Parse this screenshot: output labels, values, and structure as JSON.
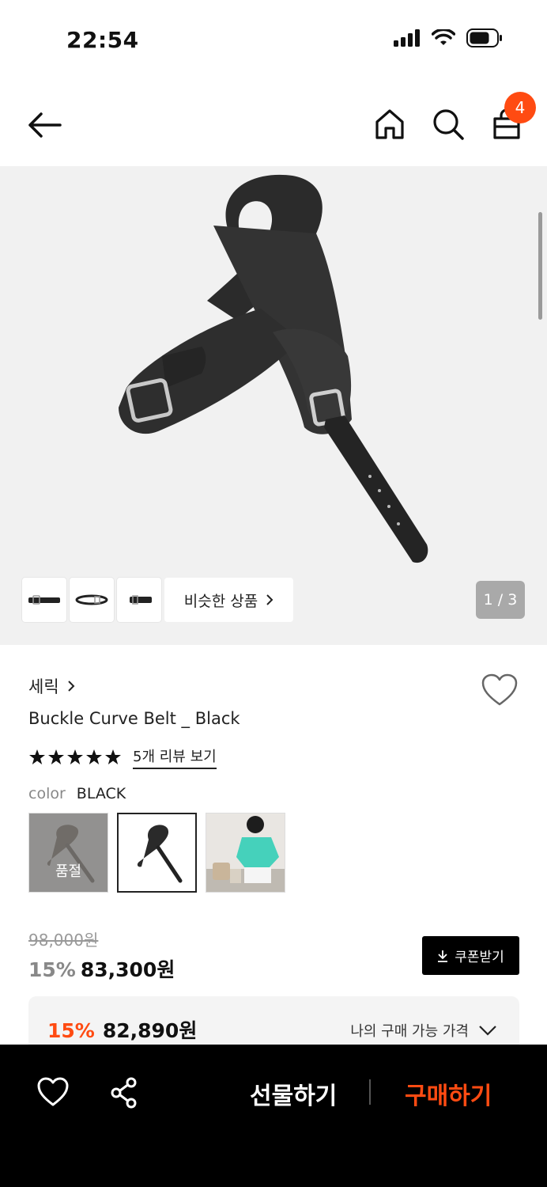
{
  "status_bar": {
    "time": "22:54"
  },
  "nav": {
    "cart_count": "4"
  },
  "gallery": {
    "similar_label": "비슷한 상품",
    "page_indicator": "1 / 3"
  },
  "product": {
    "brand": "세릭",
    "title": "Buckle Curve Belt _ Black",
    "rating_stars": 5,
    "review_link": "5개 리뷰 보기",
    "color_label": "color",
    "color_value": "BLACK",
    "soldout_label": "품절"
  },
  "price": {
    "original": "98,000원",
    "discount_pct": "15%",
    "sale": "83,300원",
    "coupon_label": "쿠폰받기",
    "best_pct": "15%",
    "best_price": "82,890원",
    "best_label": "나의 구매 가능 가격"
  },
  "bottom_bar": {
    "gift_label": "선물하기",
    "buy_label": "구매하기"
  },
  "colors": {
    "accent": "#ff4b12",
    "background": "#ffffff",
    "gallery_bg": "#f1f1f1"
  }
}
